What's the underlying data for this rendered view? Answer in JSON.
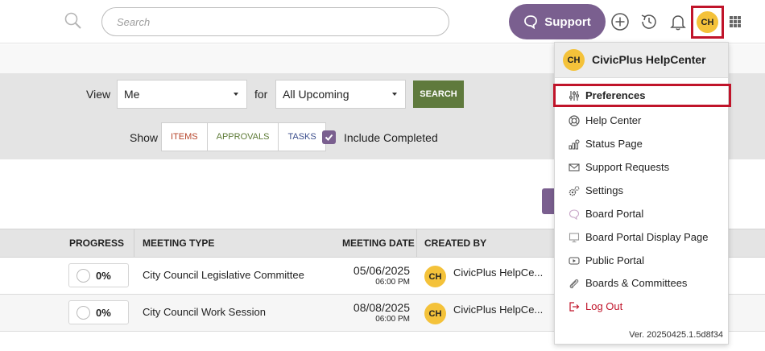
{
  "header": {
    "search_placeholder": "Search",
    "support_label": "Support",
    "user_initials": "CH"
  },
  "filters": {
    "view_label": "View",
    "view_value": "Me",
    "for_label": "for",
    "for_value": "All Upcoming",
    "search_button": "SEARCH",
    "show_label": "Show",
    "toggles": [
      "ITEMS",
      "APPROVALS",
      "TASKS"
    ],
    "include_completed_label": "Include Completed",
    "include_completed_checked": true
  },
  "table": {
    "columns": [
      "PROGRESS",
      "MEETING TYPE",
      "MEETING DATE",
      "CREATED BY"
    ],
    "rows": [
      {
        "progress": "0%",
        "meeting_type": "City Council Legislative Committee",
        "date": "05/06/2025",
        "time": "06:00 PM",
        "creator_initials": "CH",
        "created_by": "CivicPlus HelpCe..."
      },
      {
        "progress": "0%",
        "meeting_type": "City Council Work Session",
        "date": "08/08/2025",
        "time": "06:00 PM",
        "creator_initials": "CH",
        "created_by": "CivicPlus HelpCe..."
      }
    ]
  },
  "user_menu": {
    "initials": "CH",
    "name": "CivicPlus HelpCenter",
    "items": [
      {
        "label": "Preferences",
        "icon": "sliders-icon"
      },
      {
        "label": "Help Center",
        "icon": "lifebuoy-icon"
      },
      {
        "label": "Status Page",
        "icon": "status-chart-icon"
      },
      {
        "label": "Support Requests",
        "icon": "envelope-icon"
      },
      {
        "label": "Settings",
        "icon": "gears-icon"
      },
      {
        "label": "Board Portal",
        "icon": "chat-bubble-icon"
      },
      {
        "label": "Board Portal Display Page",
        "icon": "monitor-icon"
      },
      {
        "label": "Public Portal",
        "icon": "video-icon"
      },
      {
        "label": "Boards & Committees",
        "icon": "paperclip-icon"
      },
      {
        "label": "Log Out",
        "icon": "logout-icon"
      }
    ],
    "version": "Ver. 20250425.1.5d8f34"
  },
  "colors": {
    "brand_purple": "#7a5f8f",
    "search_green": "#5f7a3d",
    "highlight_red": "#c0142a",
    "avatar_yellow": "#f4c23a"
  }
}
